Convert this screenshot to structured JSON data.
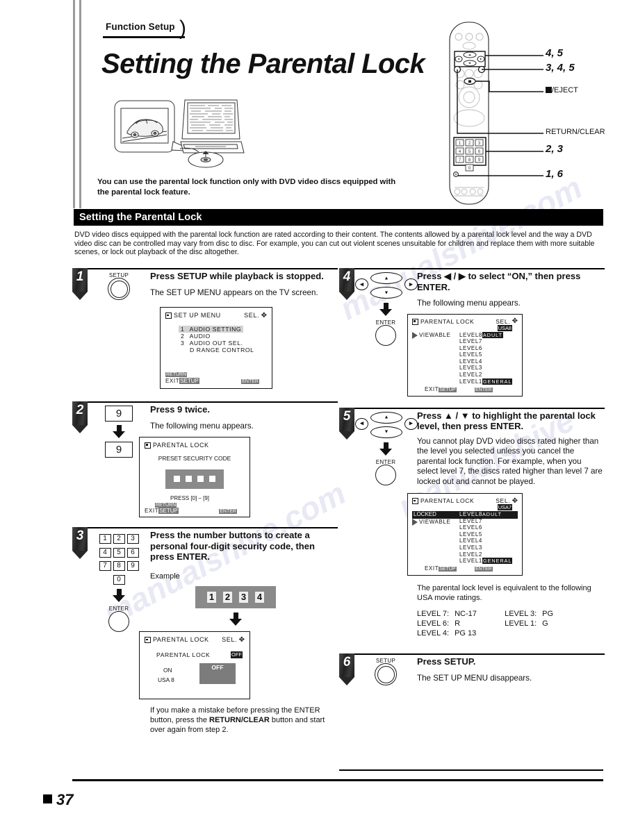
{
  "page": {
    "tab_label": "Function Setup",
    "title": "Setting the Parental Lock",
    "intro_note": "You can use the parental lock function only with DVD video discs equipped with the parental lock feature.",
    "section_title": "Setting the Parental Lock",
    "section_intro": "DVD video discs equipped with the parental lock function are rated according to their content. The contents allowed by a parental lock level and the way a DVD video disc can be controlled may vary from disc to disc. For example, you can cut out violent scenes unsuitable for children and replace them with more suitable scenes, or lock out playback of the disc altogether.",
    "page_number": "37"
  },
  "remote_callouts": [
    {
      "text": "4, 5",
      "style": "italic"
    },
    {
      "text": "3, 4, 5",
      "style": "italic"
    },
    {
      "text": "/EJECT",
      "style": "plain"
    },
    {
      "text": "RETURN/CLEAR",
      "style": "plain"
    },
    {
      "text": "2, 3",
      "style": "italic"
    },
    {
      "text": "1, 6",
      "style": "italic"
    }
  ],
  "steps": {
    "s1": {
      "num": "1",
      "button_label": "SETUP",
      "heading": "Press SETUP while playback is stopped.",
      "sub": "The SET UP MENU appears on the TV screen.",
      "osd": {
        "title": "SET UP MENU",
        "sel": "SEL.",
        "rows": [
          {
            "num": "1",
            "label": "AUDIO SETTING",
            "highlight": true
          },
          {
            "num": "2",
            "label": "AUDIO",
            "highlight": false
          },
          {
            "num": "3",
            "label": "AUDIO OUT SEL.",
            "highlight": false
          },
          {
            "num": "",
            "label": "D RANGE CONTROL",
            "highlight": false
          }
        ],
        "return_tag": "RETURN",
        "exit_label": "EXIT",
        "setup_tag": "SETUP",
        "enter_tag": "ENTER"
      }
    },
    "s2": {
      "num": "2",
      "key_top": "9",
      "key_bottom": "9",
      "heading": "Press 9 twice.",
      "sub": "The following menu appears.",
      "osd": {
        "title": "PARENTAL LOCK",
        "subtitle": "PRESET SECURITY CODE",
        "press_hint": "PRESS  [0] – [9]",
        "return_tag": "RETURN",
        "exit_label": "EXIT",
        "setup_tag": "SETUP",
        "enter_tag": "ENTER"
      }
    },
    "s3": {
      "num": "3",
      "keypad": [
        "1",
        "2",
        "3",
        "4",
        "5",
        "6",
        "7",
        "8",
        "9",
        "0"
      ],
      "enter_label": "ENTER",
      "heading": "Press the number buttons to create a personal four-digit security code, then press ENTER.",
      "example_label": "Example",
      "example_digits": [
        "1",
        "2",
        "3",
        "4"
      ],
      "osd": {
        "title": "PARENTAL LOCK",
        "sel": "SEL.",
        "row_label": "PARENTAL LOCK",
        "row_value": "OFF",
        "opt_on": "ON",
        "opt_off": "OFF",
        "usa_label": "USA 8"
      },
      "mistake_1": "If you make a mistake before pressing the ENTER button, press the ",
      "mistake_bold": "RETURN/CLEAR",
      "mistake_2": " button and start over again from step 2."
    },
    "s4": {
      "num": "4",
      "enter_label": "ENTER",
      "heading": "Press ◀ / ▶ to select “ON,” then press ENTER.",
      "sub": "The following menu appears.",
      "osd": {
        "title": "PARENTAL LOCK",
        "sel": "SEL.",
        "usa_tag": "USA8",
        "state_label": "VIEWABLE",
        "locked_label": "",
        "levels": [
          "LEVEL8",
          "LEVEL7",
          "LEVEL6",
          "LEVEL5",
          "LEVEL4",
          "LEVEL3",
          "LEVEL2",
          "LEVEL1"
        ],
        "adult_tag": "ADULT",
        "general_tag": "GENERAL",
        "exit_label": "EXIT",
        "setup_tag": "SETUP",
        "enter_tag": "ENTER"
      }
    },
    "s5": {
      "num": "5",
      "enter_label": "ENTER",
      "heading": "Press ▲ / ▼ to highlight the parental lock level, then press ENTER.",
      "sub": "You cannot play DVD video discs rated higher than the level you selected unless you cancel the parental lock function. For example, when you select level 7, the discs rated higher than level 7 are locked out and cannot be played.",
      "osd": {
        "title": "PARENTAL LOCK",
        "sel": "SEL.",
        "usa_tag": "USA7",
        "locked_label": "LOCKED",
        "state_label": "VIEWABLE",
        "levels": [
          "LEVEL8",
          "LEVEL7",
          "LEVEL6",
          "LEVEL5",
          "LEVEL4",
          "LEVEL3",
          "LEVEL2",
          "LEVEL1"
        ],
        "adult_tag": "ADULT",
        "general_tag": "GENERAL",
        "exit_label": "EXIT",
        "setup_tag": "SETUP",
        "enter_tag": "ENTER"
      },
      "ratings_intro": "The parental lock level is equivalent to the following USA movie ratings.",
      "ratings": [
        {
          "left_level": "LEVEL 7:",
          "left_value": "NC-17",
          "right_level": "LEVEL 3:",
          "right_value": "PG"
        },
        {
          "left_level": "LEVEL 6:",
          "left_value": "R",
          "right_level": "LEVEL 1:",
          "right_value": "G"
        },
        {
          "left_level": "LEVEL 4:",
          "left_value": "PG 13",
          "right_level": "",
          "right_value": ""
        }
      ]
    },
    "s6": {
      "num": "6",
      "button_label": "SETUP",
      "heading": "Press SETUP.",
      "sub": "The SET UP MENU disappears."
    }
  }
}
